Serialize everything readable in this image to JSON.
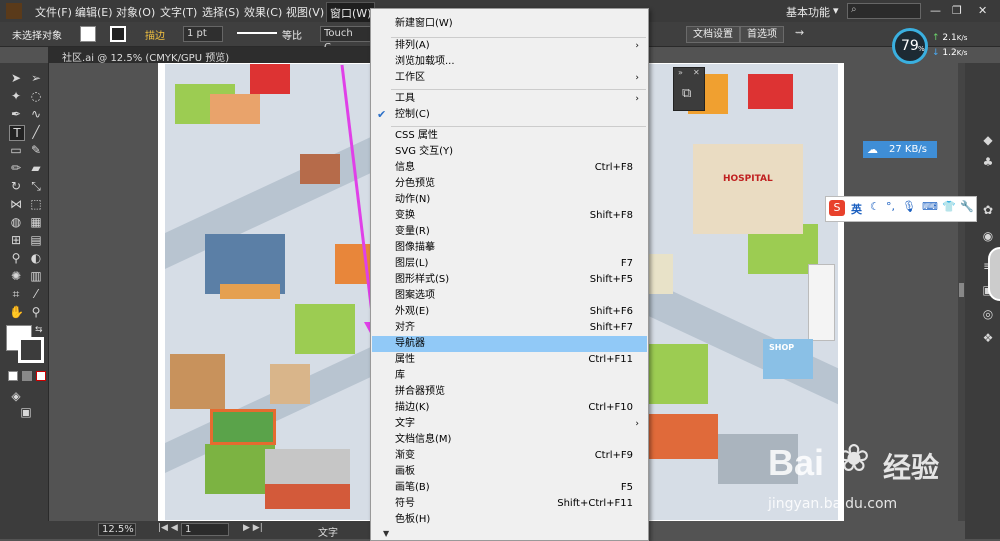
{
  "menubar": {
    "items": [
      "文件(F)",
      "编辑(E)",
      "对象(O)",
      "文字(T)",
      "选择(S)",
      "效果(C)",
      "视图(V)",
      "窗口(W)"
    ],
    "workspace": "基本功能"
  },
  "control": {
    "selection_status": "未选择对象",
    "stroke_label": "描边",
    "stroke_value": "1 pt",
    "stroke_profile": "等比",
    "brush": "Touch C...",
    "doc_settings": "文档设置",
    "preferences": "首选项"
  },
  "document": {
    "tab_title": "社区.ai @ 12.5% (CMYK/GPU 预览)"
  },
  "status": {
    "zoom": "12.5%",
    "artboard": "1",
    "tool": "文字"
  },
  "window_menu": {
    "items": [
      {
        "label": "新建窗口(W)",
        "shortcut": ""
      },
      {
        "label": "排列(A)",
        "shortcut": "",
        "submenu": true
      },
      {
        "label": "浏览加载项...",
        "shortcut": ""
      },
      {
        "label": "工作区",
        "shortcut": "",
        "submenu": true
      },
      {
        "label": "工具",
        "shortcut": "",
        "submenu": true
      },
      {
        "label": "控制(C)",
        "shortcut": "",
        "checked": true
      },
      {
        "label": "CSS 属性",
        "shortcut": ""
      },
      {
        "label": "SVG 交互(Y)",
        "shortcut": ""
      },
      {
        "label": "信息",
        "shortcut": "Ctrl+F8"
      },
      {
        "label": "分色预览",
        "shortcut": ""
      },
      {
        "label": "动作(N)",
        "shortcut": ""
      },
      {
        "label": "变换",
        "shortcut": "Shift+F8"
      },
      {
        "label": "变量(R)",
        "shortcut": ""
      },
      {
        "label": "图像描摹",
        "shortcut": ""
      },
      {
        "label": "图层(L)",
        "shortcut": "F7"
      },
      {
        "label": "图形样式(S)",
        "shortcut": "Shift+F5"
      },
      {
        "label": "图案选项",
        "shortcut": ""
      },
      {
        "label": "外观(E)",
        "shortcut": "Shift+F6"
      },
      {
        "label": "对齐",
        "shortcut": "Shift+F7"
      },
      {
        "label": "导航器",
        "shortcut": "",
        "highlighted": true
      },
      {
        "label": "属性",
        "shortcut": "Ctrl+F11"
      },
      {
        "label": "库",
        "shortcut": ""
      },
      {
        "label": "拼合器预览",
        "shortcut": ""
      },
      {
        "label": "描边(K)",
        "shortcut": "Ctrl+F10"
      },
      {
        "label": "文字",
        "shortcut": "",
        "submenu": true
      },
      {
        "label": "文档信息(M)",
        "shortcut": ""
      },
      {
        "label": "渐变",
        "shortcut": "Ctrl+F9"
      },
      {
        "label": "画板",
        "shortcut": ""
      },
      {
        "label": "画笔(B)",
        "shortcut": "F5"
      },
      {
        "label": "符号",
        "shortcut": "Shift+Ctrl+F11"
      },
      {
        "label": "色板(H)",
        "shortcut": ""
      }
    ]
  },
  "netmonitor": {
    "percent": "79",
    "percent_sign": "%",
    "up": "2.1",
    "down": "1.2",
    "unit": "K/s"
  },
  "download_speed": "27 KB/s",
  "ime": {
    "mode": "英"
  },
  "canvas_text": {
    "hospital": "HOSPITAL",
    "shop": "SHOP"
  },
  "watermark": {
    "brand": "Bai",
    "brand2": "经验",
    "url": "jingyan.baidu.com"
  },
  "colors": {
    "highlight": "#91c9f7",
    "arrow": "#e040e8",
    "speed_badge": "#3f8ed6",
    "check": "#2b6fc7"
  }
}
